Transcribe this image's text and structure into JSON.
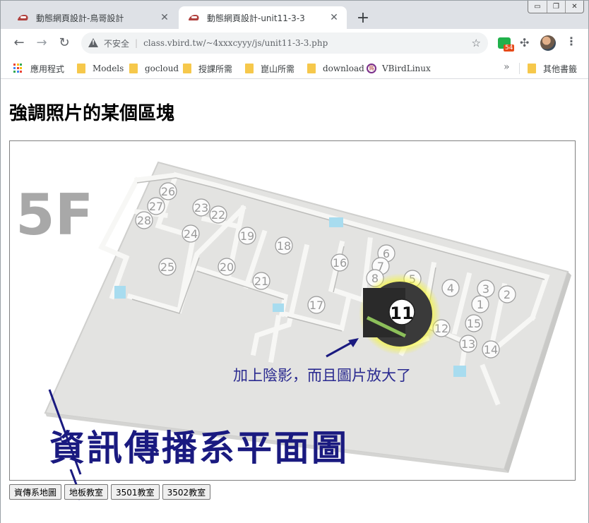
{
  "browser": {
    "tabs": [
      {
        "title": "動態網頁設計-鳥哥設計"
      },
      {
        "title": "動態網頁設計-unit11-3-3"
      }
    ],
    "new_tab_label": "+",
    "window_controls": {
      "minimize": "▭",
      "restore": "❐",
      "close": "✕"
    },
    "address": {
      "insecure_label": "不安全",
      "url": "class.vbird.tw/~4xxxcyyy/js/unit11-3-3.php"
    },
    "extension_badge": "54",
    "bookmarks": [
      {
        "label": "應用程式",
        "icon": "apps-grid-icon"
      },
      {
        "label": "Models",
        "icon": "folder-icon"
      },
      {
        "label": "gocloud",
        "icon": "folder-icon"
      },
      {
        "label": "授課所需",
        "icon": "folder-icon"
      },
      {
        "label": "崑山所需",
        "icon": "folder-icon"
      },
      {
        "label": "download",
        "icon": "folder-icon"
      },
      {
        "label": "VBirdLinux",
        "icon": "vbird-icon"
      }
    ],
    "bookmarks_more": "»",
    "other_bookmarks": "其他書籤"
  },
  "page": {
    "heading": "強調照片的某個區塊",
    "map": {
      "floor_label": "5F",
      "rooms": [
        "26",
        "27",
        "28",
        "23",
        "22",
        "24",
        "19",
        "18",
        "25",
        "20",
        "21",
        "16",
        "6",
        "7",
        "8",
        "5",
        "4",
        "3",
        "2",
        "1",
        "17",
        "15",
        "12",
        "13",
        "14"
      ],
      "highlight_room": "11",
      "annotation": "加上陰影，而且圖片放大了",
      "caption": "資訊傳播系平面圖"
    },
    "buttons": [
      "資傳系地圖",
      "地板教室",
      "3501教室",
      "3502教室"
    ]
  }
}
